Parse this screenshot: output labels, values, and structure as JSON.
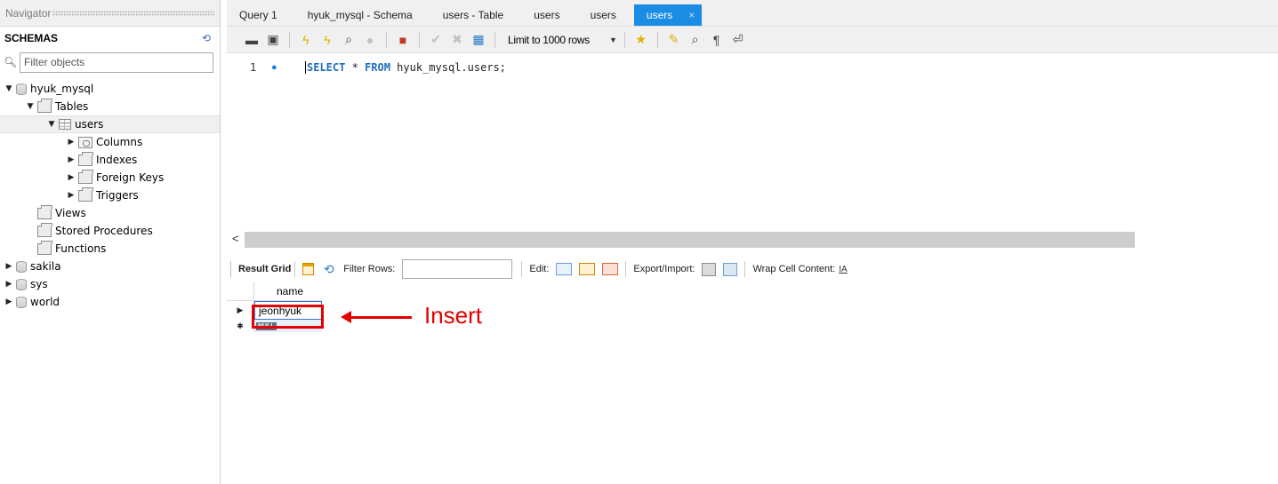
{
  "navigator": {
    "title": "Navigator",
    "schemas_label": "SCHEMAS",
    "filter_placeholder": "Filter objects",
    "tree": {
      "hyuk_mysql": "hyuk_mysql",
      "tables": "Tables",
      "users": "users",
      "columns": "Columns",
      "indexes": "Indexes",
      "foreign_keys": "Foreign Keys",
      "triggers": "Triggers",
      "views": "Views",
      "stored_procedures": "Stored Procedures",
      "functions": "Functions",
      "sakila": "sakila",
      "sys": "sys",
      "world": "world"
    }
  },
  "tabs": [
    {
      "label": "Query 1"
    },
    {
      "label": "hyuk_mysql - Schema"
    },
    {
      "label": "users - Table"
    },
    {
      "label": "users"
    },
    {
      "label": "users"
    },
    {
      "label": "users",
      "close": "×"
    }
  ],
  "toolbar": {
    "limit_label": "Limit to 1000 rows"
  },
  "editor": {
    "line_number": "1",
    "keyword_select": "SELECT",
    "star": " * ",
    "keyword_from": "FROM",
    "table_ref": " hyuk_mysql.users;"
  },
  "result_bar": {
    "result_grid": "Result Grid",
    "filter_rows": "Filter Rows:",
    "edit": "Edit:",
    "export_import": "Export/Import:",
    "wrap_cell": "Wrap Cell Content:",
    "wrap_icon": "IA"
  },
  "grid": {
    "column_header": "name",
    "rows": [
      "jeonhyuk"
    ],
    "null_badge": "NULL"
  },
  "annotation": {
    "text": "Insert",
    "color": "#e30000"
  },
  "colors": {
    "active_tab": "#1a8ce4",
    "keyword": "#1e6fbd"
  }
}
